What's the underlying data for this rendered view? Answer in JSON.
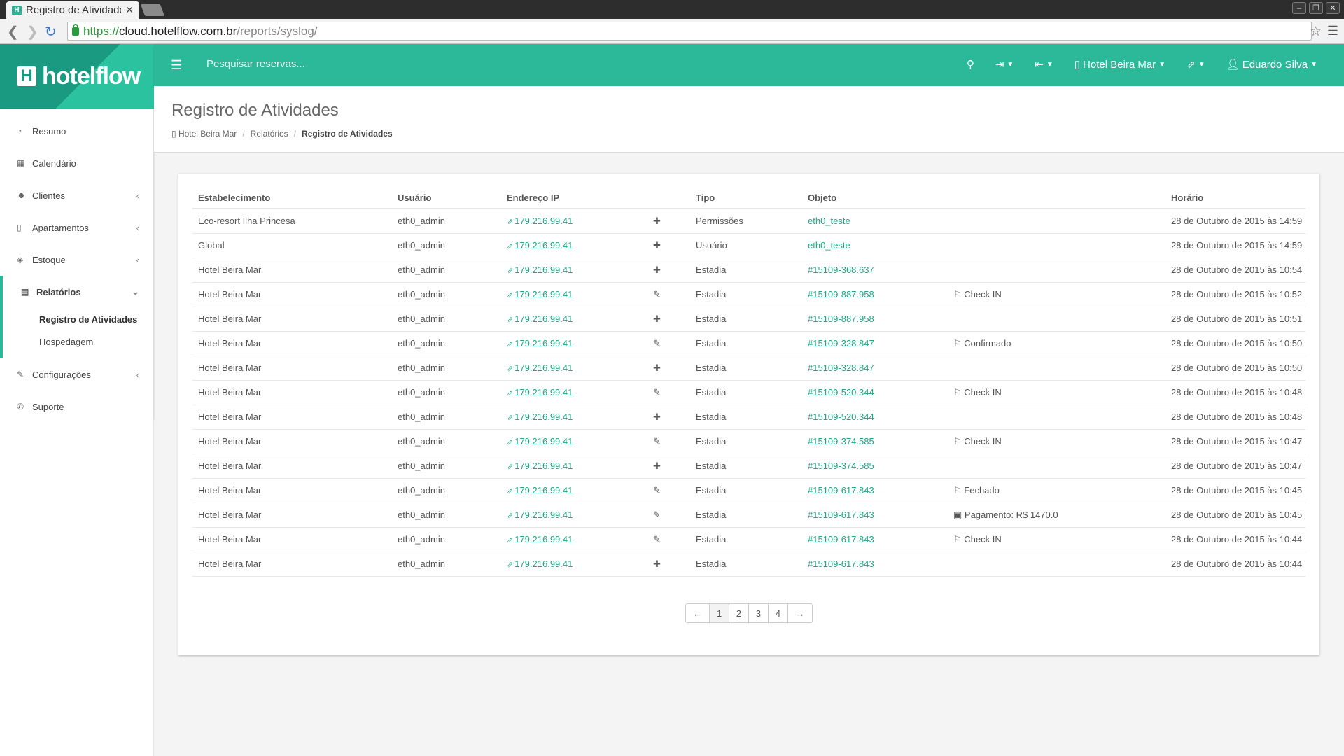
{
  "browser": {
    "tab_title": "Registro de Atividades",
    "url_proto": "https://",
    "url_host": "cloud.hotelflow.com.br",
    "url_path": "/reports/syslog/"
  },
  "app": {
    "logo_text": "hotelflow",
    "search_placeholder": "Pesquisar reservas...",
    "hotel": "Hotel Beira Mar",
    "user": "Eduardo Silva"
  },
  "sidebar": {
    "items": [
      {
        "label": "Resumo",
        "icon": "dashboard-icon",
        "glyph": "◔"
      },
      {
        "label": "Calendário",
        "icon": "calendar-icon",
        "glyph": "▦"
      },
      {
        "label": "Clientes",
        "icon": "users-icon",
        "glyph": "☻"
      },
      {
        "label": "Apartamentos",
        "icon": "building-icon",
        "glyph": "▯"
      },
      {
        "label": "Estoque",
        "icon": "cubes-icon",
        "glyph": "◈"
      }
    ],
    "group": {
      "label": "Relatórios",
      "icon": "reports-icon",
      "glyph": "▤",
      "sub": [
        "Registro de Atividades",
        "Hospedagem"
      ]
    },
    "items_after": [
      {
        "label": "Configurações",
        "icon": "wrench-icon",
        "glyph": "✎"
      },
      {
        "label": "Suporte",
        "icon": "support-icon",
        "glyph": "✆"
      }
    ]
  },
  "page": {
    "title": "Registro de Atividades",
    "breadcrumb": [
      "Hotel Beira Mar",
      "Relatórios",
      "Registro de Atividades"
    ]
  },
  "table": {
    "headers": [
      "Estabelecimento",
      "Usuário",
      "Endereço IP",
      "",
      "Tipo",
      "Objeto",
      "",
      "Horário"
    ],
    "rows": [
      {
        "estab": "Eco-resort Ilha Princesa",
        "user": "eth0_admin",
        "ip": "179.216.99.41",
        "action": "add",
        "tipo": "Permissões",
        "obj": "eth0_teste",
        "extra": "",
        "extra_icon": "",
        "time": "28 de Outubro de 2015 às 14:59"
      },
      {
        "estab": "Global",
        "user": "eth0_admin",
        "ip": "179.216.99.41",
        "action": "add",
        "tipo": "Usuário",
        "obj": "eth0_teste",
        "extra": "",
        "extra_icon": "",
        "time": "28 de Outubro de 2015 às 14:59"
      },
      {
        "estab": "Hotel Beira Mar",
        "user": "eth0_admin",
        "ip": "179.216.99.41",
        "action": "add",
        "tipo": "Estadia",
        "obj": "#15109-368.637",
        "extra": "",
        "extra_icon": "",
        "time": "28 de Outubro de 2015 às 10:54"
      },
      {
        "estab": "Hotel Beira Mar",
        "user": "eth0_admin",
        "ip": "179.216.99.41",
        "action": "edit",
        "tipo": "Estadia",
        "obj": "#15109-887.958",
        "extra": "Check IN",
        "extra_icon": "flag",
        "time": "28 de Outubro de 2015 às 10:52"
      },
      {
        "estab": "Hotel Beira Mar",
        "user": "eth0_admin",
        "ip": "179.216.99.41",
        "action": "add",
        "tipo": "Estadia",
        "obj": "#15109-887.958",
        "extra": "",
        "extra_icon": "",
        "time": "28 de Outubro de 2015 às 10:51"
      },
      {
        "estab": "Hotel Beira Mar",
        "user": "eth0_admin",
        "ip": "179.216.99.41",
        "action": "edit",
        "tipo": "Estadia",
        "obj": "#15109-328.847",
        "extra": "Confirmado",
        "extra_icon": "flag",
        "time": "28 de Outubro de 2015 às 10:50"
      },
      {
        "estab": "Hotel Beira Mar",
        "user": "eth0_admin",
        "ip": "179.216.99.41",
        "action": "add",
        "tipo": "Estadia",
        "obj": "#15109-328.847",
        "extra": "",
        "extra_icon": "",
        "time": "28 de Outubro de 2015 às 10:50"
      },
      {
        "estab": "Hotel Beira Mar",
        "user": "eth0_admin",
        "ip": "179.216.99.41",
        "action": "edit",
        "tipo": "Estadia",
        "obj": "#15109-520.344",
        "extra": "Check IN",
        "extra_icon": "flag",
        "time": "28 de Outubro de 2015 às 10:48"
      },
      {
        "estab": "Hotel Beira Mar",
        "user": "eth0_admin",
        "ip": "179.216.99.41",
        "action": "add",
        "tipo": "Estadia",
        "obj": "#15109-520.344",
        "extra": "",
        "extra_icon": "",
        "time": "28 de Outubro de 2015 às 10:48"
      },
      {
        "estab": "Hotel Beira Mar",
        "user": "eth0_admin",
        "ip": "179.216.99.41",
        "action": "edit",
        "tipo": "Estadia",
        "obj": "#15109-374.585",
        "extra": "Check IN",
        "extra_icon": "flag",
        "time": "28 de Outubro de 2015 às 10:47"
      },
      {
        "estab": "Hotel Beira Mar",
        "user": "eth0_admin",
        "ip": "179.216.99.41",
        "action": "add",
        "tipo": "Estadia",
        "obj": "#15109-374.585",
        "extra": "",
        "extra_icon": "",
        "time": "28 de Outubro de 2015 às 10:47"
      },
      {
        "estab": "Hotel Beira Mar",
        "user": "eth0_admin",
        "ip": "179.216.99.41",
        "action": "edit",
        "tipo": "Estadia",
        "obj": "#15109-617.843",
        "extra": "Fechado",
        "extra_icon": "flag",
        "time": "28 de Outubro de 2015 às 10:45"
      },
      {
        "estab": "Hotel Beira Mar",
        "user": "eth0_admin",
        "ip": "179.216.99.41",
        "action": "edit",
        "tipo": "Estadia",
        "obj": "#15109-617.843",
        "extra": "Pagamento: R$ 1470.0",
        "extra_icon": "money",
        "time": "28 de Outubro de 2015 às 10:45"
      },
      {
        "estab": "Hotel Beira Mar",
        "user": "eth0_admin",
        "ip": "179.216.99.41",
        "action": "edit",
        "tipo": "Estadia",
        "obj": "#15109-617.843",
        "extra": "Check IN",
        "extra_icon": "flag",
        "time": "28 de Outubro de 2015 às 10:44"
      },
      {
        "estab": "Hotel Beira Mar",
        "user": "eth0_admin",
        "ip": "179.216.99.41",
        "action": "add",
        "tipo": "Estadia",
        "obj": "#15109-617.843",
        "extra": "",
        "extra_icon": "",
        "time": "28 de Outubro de 2015 às 10:44"
      }
    ]
  },
  "pagination": {
    "prev": "←",
    "pages": [
      "1",
      "2",
      "3",
      "4"
    ],
    "next": "→"
  },
  "colors": {
    "accent": "#2bb99a",
    "link": "#1fa787"
  }
}
